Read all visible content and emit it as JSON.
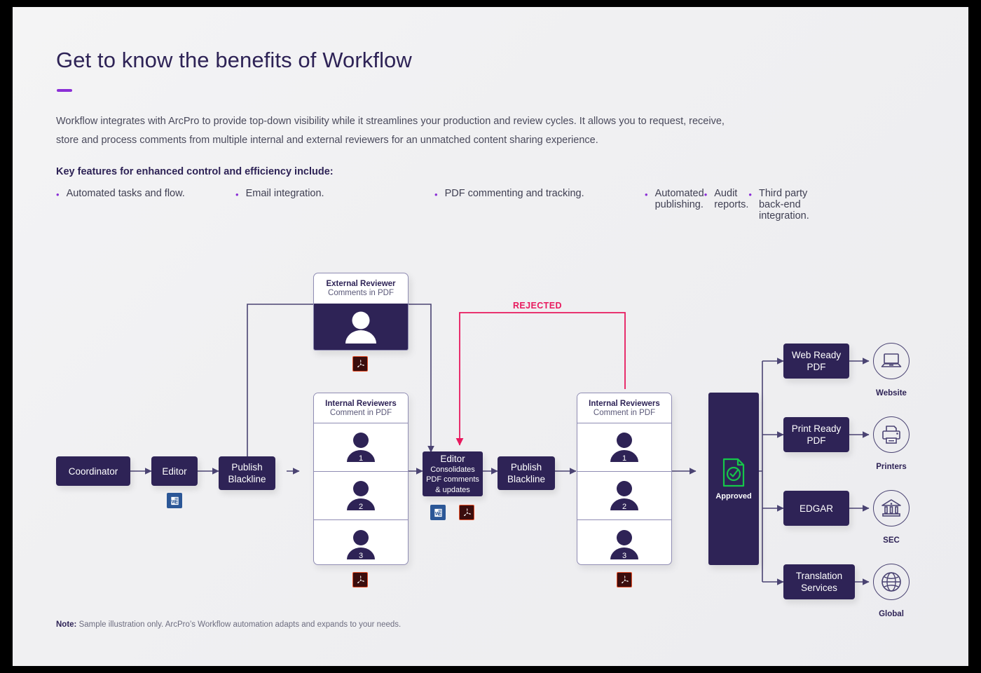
{
  "header": {
    "title": "Get to know the benefits of Workflow",
    "intro": "Workflow integrates with ArcPro to provide top-down visibility while it streamlines your production and review cycles. It allows you to request, receive, store and process comments from multiple internal and external reviewers for an unmatched content sharing experience.",
    "features_title": "Key features for enhanced control and efficiency include:",
    "features": [
      "Automated tasks and flow.",
      "Email integration.",
      "PDF commenting and tracking.",
      "Automated publishing.",
      "Audit reports.",
      "Third party back-end integration."
    ]
  },
  "note": {
    "label": "Note:",
    "text": " Sample illustration only. ArcPro’s Workflow automation adapts and expands to your needs."
  },
  "diagram": {
    "coordinator": "Coordinator",
    "editor_1": "Editor",
    "publish_blackline_1": {
      "line1": "Publish",
      "line2": "Blackline"
    },
    "external_reviewer": {
      "title": "External Reviewer",
      "subtitle": "Comments in PDF"
    },
    "internal_reviewers_left": {
      "title": "Internal Reviewers",
      "subtitle": "Comment in PDF",
      "people": [
        "1",
        "2",
        "3"
      ]
    },
    "internal_reviewers_right": {
      "title": "Internal Reviewers",
      "subtitle": "Comment in PDF",
      "people": [
        "1",
        "2",
        "3"
      ]
    },
    "editor_consolidate": {
      "title": "Editor",
      "line1": "Consolidates",
      "line2": "PDF comments",
      "line3": "& updates"
    },
    "publish_blackline_2": {
      "line1": "Publish",
      "line2": "Blackline"
    },
    "rejected_label": "REJECTED",
    "approved_label": "Approved",
    "outputs": [
      {
        "box_line1": "Web Ready",
        "box_line2": "PDF",
        "icon": "laptop-icon",
        "target": "Website"
      },
      {
        "box_line1": "Print Ready",
        "box_line2": "PDF",
        "icon": "printer-icon",
        "target": "Printers"
      },
      {
        "box_line1": "EDGAR",
        "box_line2": "",
        "icon": "bank-icon",
        "target": "SEC"
      },
      {
        "box_line1": "Translation",
        "box_line2": "Services",
        "icon": "globe-icon",
        "target": "Global"
      }
    ],
    "file_icons": [
      "pdf-icon",
      "word-icon"
    ]
  },
  "colors": {
    "brand_purple": "#2e2356",
    "accent_violet": "#8b2fd6",
    "rejected_pink": "#e8195e",
    "approved_green": "#16c64a",
    "connector": "#4a4372",
    "page_bg": "#f2f2f4"
  }
}
